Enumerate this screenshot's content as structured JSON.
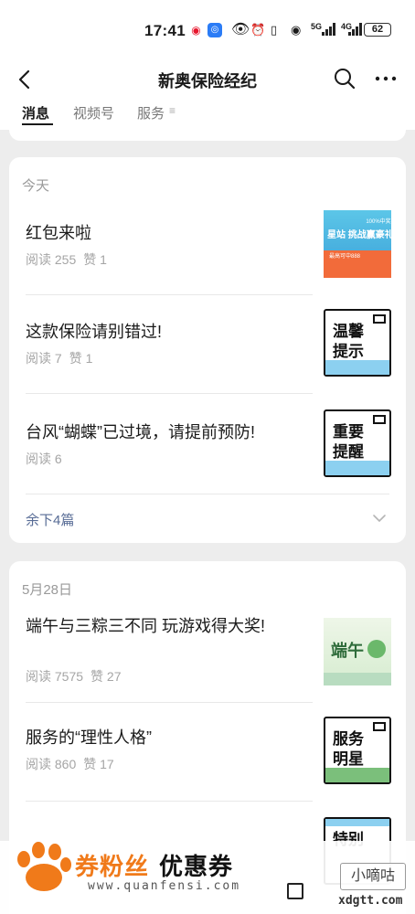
{
  "status_bar": {
    "time": "17:41",
    "battery": "62",
    "net_5g": "5G",
    "net_4g": "4G"
  },
  "nav": {
    "title": "新奥保险经纪"
  },
  "tabs": [
    {
      "label": "消息",
      "active": true
    },
    {
      "label": "视频号",
      "active": false
    },
    {
      "label": "服务",
      "active": false
    }
  ],
  "groups": [
    {
      "date": "今天",
      "articles": [
        {
          "title": "红包来啦",
          "reads": "阅读 255",
          "likes": "赞 1"
        },
        {
          "title": "这款保险请别错过!",
          "reads": "阅读 7",
          "likes": "赞 1",
          "thumb_text": "温馨\n提示"
        },
        {
          "title": "台风“蝴蝶”已过境，请提前预防!",
          "reads": "阅读 6",
          "likes": "",
          "thumb_text": "重要\n提醒"
        }
      ],
      "more": "余下4篇"
    },
    {
      "date": "5月28日",
      "articles": [
        {
          "title": "端午与三粽三不同 玩游戏得大奖!",
          "reads": "阅读 7575",
          "likes": "赞 27",
          "thumb_text": "端午"
        },
        {
          "title": "服务的“理性人格”",
          "reads": "阅读 860",
          "likes": "赞 17",
          "thumb_text": "服务\n明星"
        },
        {
          "title": "",
          "reads": "",
          "likes": "",
          "thumb_text": "特别"
        }
      ]
    }
  ],
  "thumb1_text": {
    "line1": "100%中奖",
    "line2": "星站 挑战赢豪礼",
    "line3": "最高可中888"
  },
  "watermark": {
    "title_a": "券粉丝",
    "title_b": "优惠券",
    "url": "www.quanfensi.com",
    "badge": "小嘀咕",
    "site": "xdgtt.com"
  },
  "colors": {
    "link": "#576b95",
    "brand_orange": "#f07a1a"
  }
}
